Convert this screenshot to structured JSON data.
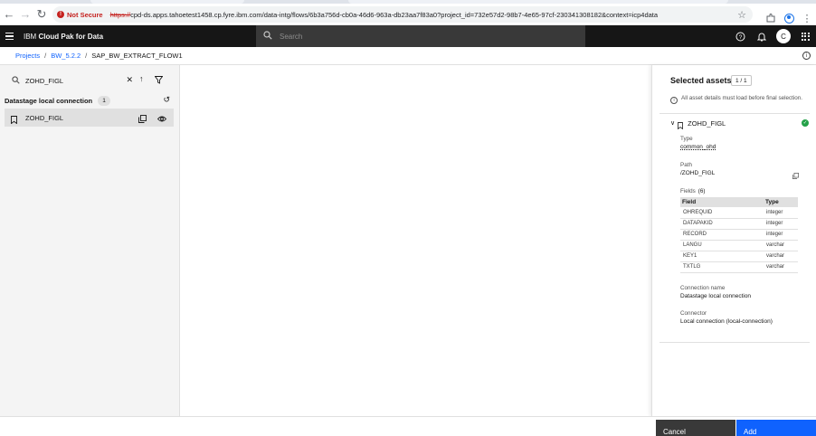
{
  "browser": {
    "security_label": "Not Secure",
    "url_scheme": "https://",
    "url_rest": "cpd-ds.apps.tahoetest1458.cp.fyre.ibm.com/data-intg/flows/6b3a756d-cb0a-46d6-963a-db23aa7f83a0?project_id=732e57d2-98b7-4e65-97cf-230341308182&context=icp4data"
  },
  "header": {
    "brand_prefix": "IBM",
    "brand_name": "Cloud Pak for Data",
    "search_placeholder": "Search",
    "avatar_initial": "C"
  },
  "breadcrumb": {
    "items": [
      "Projects",
      "BW_5.2.2"
    ],
    "current": "SAP_BW_EXTRACT_FLOW1"
  },
  "left_panel": {
    "search_value": "ZOHD_FIGL",
    "group": {
      "title": "Datastage local connection",
      "count": "1"
    },
    "items": [
      {
        "name": "ZOHD_FIGL"
      }
    ]
  },
  "selected_assets": {
    "title": "Selected assets",
    "count": "1 / 1",
    "note": "All asset details must load before final selection.",
    "asset": {
      "name": "ZOHD_FIGL",
      "type_label": "Type",
      "type_value": "common_ohd",
      "path_label": "Path",
      "path_value": "/ZOHD_FIGL",
      "fields_label": "Fields",
      "fields_count": "(6)",
      "fields_headers": [
        "Field",
        "Type"
      ],
      "fields": [
        [
          "OHREQUID",
          "integer"
        ],
        [
          "DATAPAKID",
          "integer"
        ],
        [
          "RECORD",
          "integer"
        ],
        [
          "LANGU",
          "varchar"
        ],
        [
          "KEY1",
          "varchar"
        ],
        [
          "TXTLG",
          "varchar"
        ]
      ],
      "connection_label": "Connection name",
      "connection_value": "Datastage local connection",
      "connector_label": "Connector",
      "connector_value": "Local connection (local-connection)"
    }
  },
  "footer": {
    "cancel_label": "Cancel",
    "add_label": "Add"
  },
  "colors": {
    "primary": "#0f62fe",
    "header_bg": "#161616",
    "success": "#24a148",
    "cancel_bg": "#393939"
  }
}
